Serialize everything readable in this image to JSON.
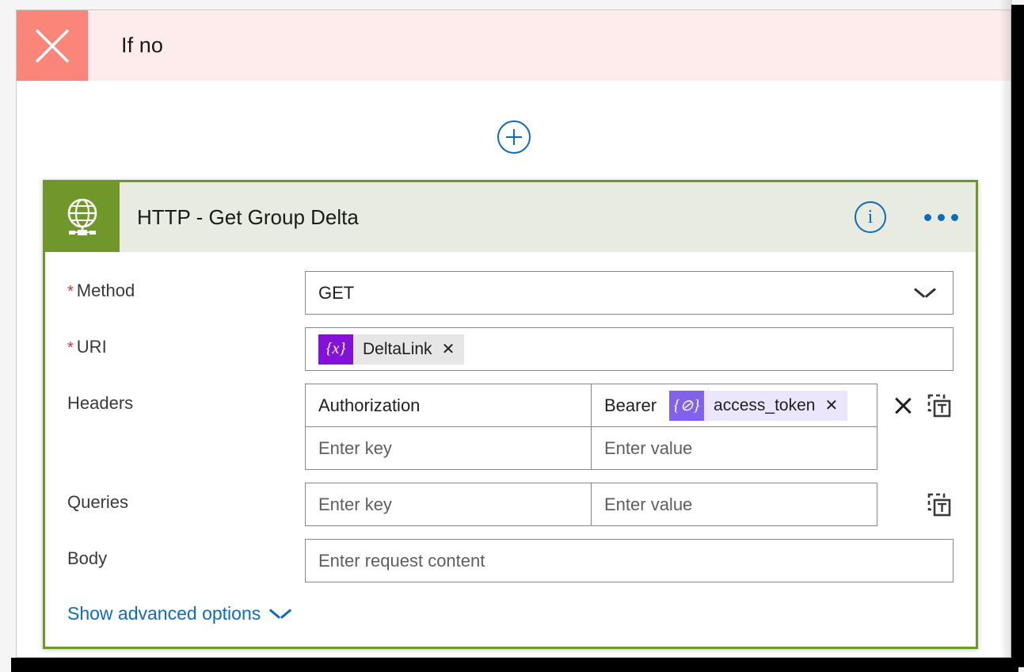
{
  "scope": {
    "title": "If no",
    "icon": "close-x-icon",
    "header_bg": "#fdeceb",
    "icon_bg": "#f98679"
  },
  "add_step": {
    "icon": "plus-circle-icon",
    "color": "#0f6cbd"
  },
  "action_card": {
    "title": "HTTP - Get Group Delta",
    "icon": "globe-network-icon",
    "accent_color": "#70972a",
    "header_bg": "#e8ece0",
    "info_icon": "info-circle-icon",
    "info_label": "i",
    "menu_icon": "ellipsis-horizontal-icon"
  },
  "fields": {
    "method": {
      "label": "Method",
      "required": true,
      "value": "GET",
      "control": "dropdown",
      "chevron_icon": "chevron-down-icon"
    },
    "uri": {
      "label": "URI",
      "required": true,
      "token": {
        "badge": "{x}",
        "label": "DeltaLink",
        "remove_icon": "token-remove-x-icon",
        "badge_color": "#8411d8",
        "body_color": "#e6e6e6"
      }
    },
    "headers": {
      "label": "Headers",
      "required": false,
      "rows": [
        {
          "key": "Authorization",
          "key_is_placeholder": false,
          "value_prefix": "Bearer",
          "value_token": {
            "badge": "{⊘}",
            "label": "access_token",
            "remove_icon": "token-remove-x-icon",
            "badge_color": "#8262e8",
            "body_color": "#ece6fc"
          }
        },
        {
          "key": "Enter key",
          "key_is_placeholder": true,
          "value": "Enter value",
          "value_is_placeholder": true
        }
      ],
      "actions": [
        {
          "icon": "delete-x-icon",
          "name": "delete-header-row"
        },
        {
          "icon": "switch-to-text-mode-icon",
          "name": "headers-text-mode"
        }
      ]
    },
    "queries": {
      "label": "Queries",
      "required": false,
      "rows": [
        {
          "key": "Enter key",
          "key_is_placeholder": true,
          "value": "Enter value",
          "value_is_placeholder": true
        }
      ],
      "actions": [
        {
          "icon": "switch-to-text-mode-icon",
          "name": "queries-text-mode"
        }
      ]
    },
    "body": {
      "label": "Body",
      "required": false,
      "placeholder": "Enter request content",
      "value": ""
    }
  },
  "advanced": {
    "label": "Show advanced options",
    "chevron_icon": "chevron-down-icon",
    "color": "#0f6cbd"
  }
}
